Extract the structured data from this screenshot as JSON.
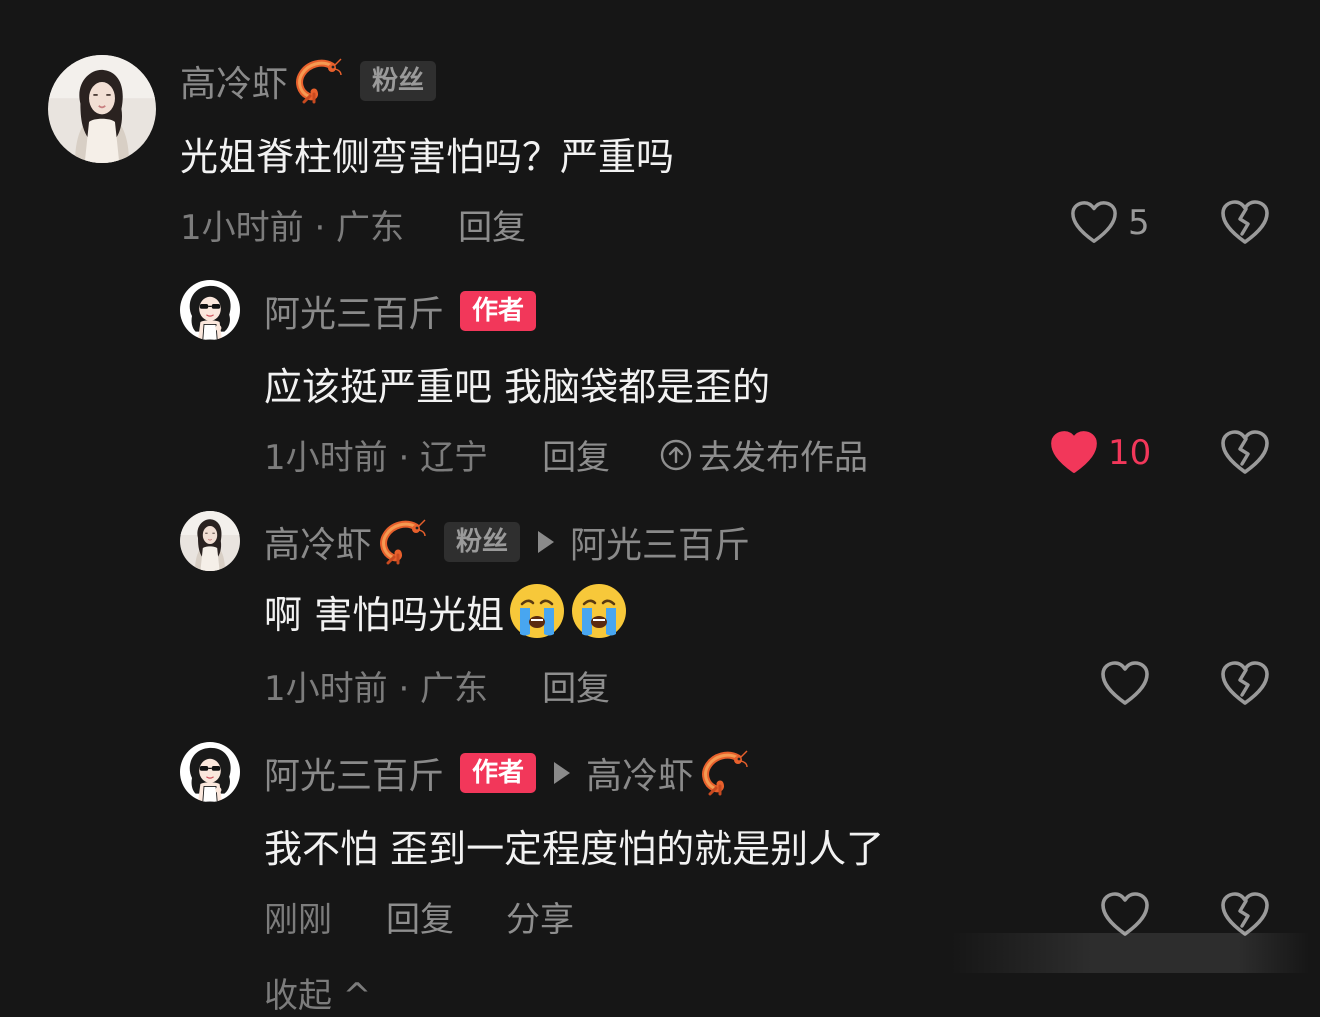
{
  "colors": {
    "background": "#161616",
    "author_badge": "#f2375a",
    "liked_heart": "#f2375a",
    "username": "#8a8a8a",
    "meta_text": "#7c7c7c"
  },
  "comments": [
    {
      "user": "高冷虾",
      "user_emoji": "shrimp-emoji",
      "badge": "粉丝",
      "text": "光姐脊柱侧弯害怕吗？严重吗",
      "time_location": "1小时前 · 广东",
      "reply_label": "回复",
      "likes": "5",
      "liked": false
    },
    {
      "user": "阿光三百斤",
      "badge": "作者",
      "text": "应该挺严重吧 我脑袋都是歪的",
      "time_location": "1小时前 · 辽宁",
      "reply_label": "回复",
      "publish_label": "去发布作品",
      "likes": "10",
      "liked": true
    },
    {
      "user": "高冷虾",
      "user_emoji": "shrimp-emoji",
      "badge": "粉丝",
      "reply_to": "阿光三百斤",
      "text": "啊 害怕吗光姐",
      "text_emojis": [
        "crying-face-emoji",
        "crying-face-emoji"
      ],
      "time_location": "1小时前 · 广东",
      "reply_label": "回复",
      "liked": false
    },
    {
      "user": "阿光三百斤",
      "badge": "作者",
      "reply_to": "高冷虾",
      "reply_to_emoji": "shrimp-emoji",
      "text": "我不怕 歪到一定程度怕的就是别人了",
      "time_location": "刚刚",
      "reply_label": "回复",
      "share_label": "分享",
      "liked": false
    }
  ],
  "collapse_label": "收起 ^"
}
